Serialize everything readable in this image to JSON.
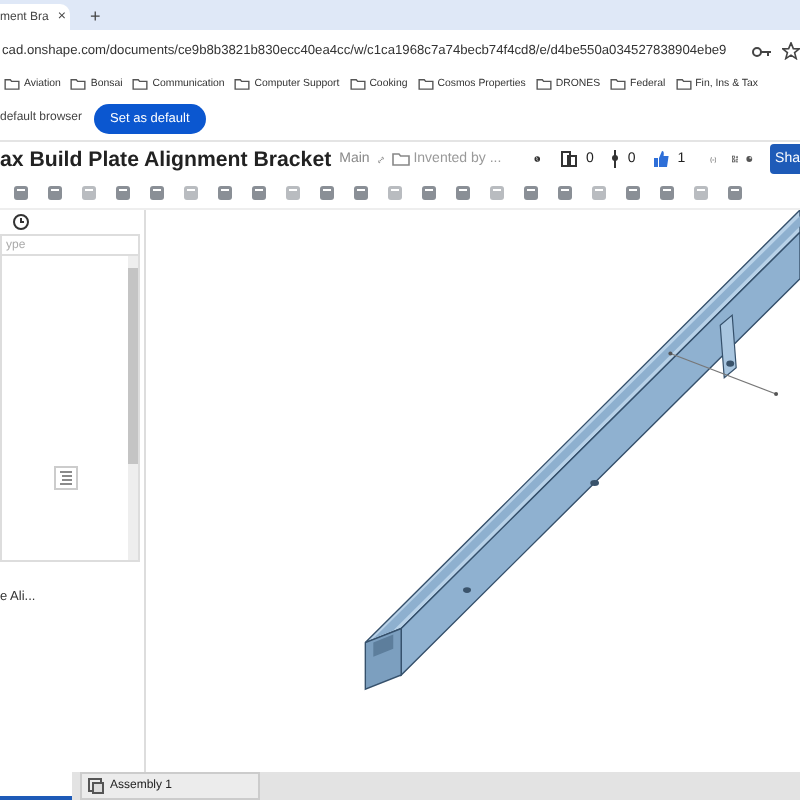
{
  "browser": {
    "tab": {
      "title": "ment Bra",
      "close": "×"
    },
    "new_tab": "+",
    "address": "cad.onshape.com/documents/ce9b8b3821b830ecc40ea4cc/w/c1ca1968c7a74becb74f4cd8/e/d4be550a034527838904ebe9",
    "bookmarks": [
      "Aviation",
      "Bonsai",
      "Communication",
      "Computer Support",
      "Cooking",
      "Cosmos Properties",
      "DRONES",
      "Federal",
      "Fin, Ins & Tax"
    ]
  },
  "infobar": {
    "text": "default browser",
    "button": "Set as default"
  },
  "document": {
    "title": "ax Build Plate Alignment Bracket",
    "branch": "Main",
    "folder": "Invented by ...",
    "counts": [
      {
        "kind": "versions",
        "value": "0"
      },
      {
        "kind": "branches",
        "value": "0"
      },
      {
        "kind": "likes",
        "value": "1"
      }
    ],
    "share": "Sha"
  },
  "panel": {
    "search": {
      "placeholder": "ype"
    },
    "item": "e Ali..."
  },
  "bottom_tabs": [
    {
      "label": "Assembly 1",
      "selected": false
    }
  ]
}
